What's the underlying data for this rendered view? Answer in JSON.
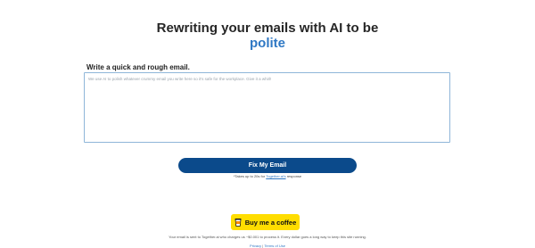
{
  "title": {
    "line1": "Rewriting your emails with AI to be",
    "accent": "polite"
  },
  "form": {
    "label": "Write a quick and rough email.",
    "placeholder": "We use AI to polish whatever crummy email you write here so it's safe for the workplace. Give it a whirl!",
    "value": "",
    "submit_label": "Fix My Email"
  },
  "note": {
    "prefix": "*Takes up to 20s for ",
    "link": "Together.ai's",
    "suffix": " response"
  },
  "coffee": {
    "label": "Buy me a coffee",
    "icon": "coffee-cup-icon",
    "color": "#ffdd00"
  },
  "footer": {
    "text": "Your email is sent to Together.ai who charges us ~$0.001 to process it. Every dollar goes a long way to keep this site running.",
    "privacy": "Privacy",
    "separator": "|",
    "terms": "Terms of Use"
  },
  "colors": {
    "accent": "#2f78c4",
    "button": "#0b4a8b"
  }
}
